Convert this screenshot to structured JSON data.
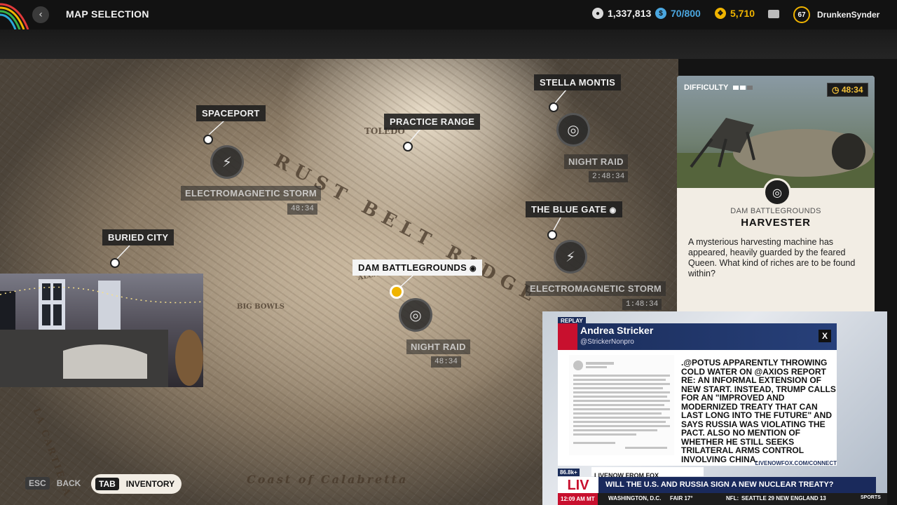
{
  "header": {
    "title": "MAP SELECTION",
    "currency_a": "1,337,813",
    "currency_b": "70/800",
    "currency_c": "5,710",
    "level": "67",
    "username": "DrunkenSynder"
  },
  "map": {
    "region_labels": [
      "RUST BELT RIDGE",
      "TOLEDO",
      "ALCANTARA",
      "BIG BOWLS",
      "LA CARTIERA",
      "Coast of Calabretta"
    ],
    "locations": [
      {
        "name": "SPACEPORT"
      },
      {
        "name": "PRACTICE RANGE"
      },
      {
        "name": "STELLA MONTIS"
      },
      {
        "name": "THE BLUE GATE"
      },
      {
        "name": "BURIED CITY"
      },
      {
        "name": "DAM BATTLEGROUNDS",
        "selected": true
      }
    ],
    "events": [
      {
        "name": "ELECTROMAGNETIC STORM",
        "timer": "48:34"
      },
      {
        "name": "NIGHT RAID",
        "timer": "2:48:34"
      },
      {
        "name": "ELECTROMAGNETIC STORM",
        "timer": "1:48:34"
      },
      {
        "name": "NIGHT RAID",
        "timer": "48:34"
      }
    ]
  },
  "card": {
    "difficulty_label": "DIFFICULTY",
    "difficulty_level": 0.4,
    "time": "48:34",
    "map": "DAM BATTLEGROUNDS",
    "event": "HARVESTER",
    "description": "A mysterious harvesting machine has appeared, heavily guarded by the feared Queen. What kind of riches are to be found within?"
  },
  "footer": {
    "back_key": "ESC",
    "back_label": "BACK",
    "inventory_key": "TAB",
    "inventory_label": "INVENTORY"
  },
  "news": {
    "replay": "REPLAY",
    "author": "Andrea Stricker",
    "handle": "@StrickerNonpro",
    "body": ".@POTUS APPARENTLY THROWING COLD WATER ON @AXIOS REPORT RE: AN INFORMAL EXTENSION OF NEW START. INSTEAD, TRUMP CALLS FOR AN \"IMPROVED AND MODERNIZED TREATY THAT CAN LAST LONG INTO THE FUTURE\" AND SAYS RUSSIA WAS VIOLATING THE PACT. ALSO NO MENTION OF WHETHER HE STILL SEEKS TRILATERAL ARMS CONTROL INVOLVING CHINA.",
    "source_url": "LIVENOWFOX.COM/CONNECT",
    "viewers": "86.8k+",
    "channel": "LIVENOW FROM FOX",
    "headline": "WILL THE U.S. AND RUSSIA SIGN A NEW NUCLEAR TREATY?",
    "time": "12:09 AM MT",
    "city": "WASHINGTON, D.C.",
    "weather": "FAIR 17°",
    "score_label": "NFL:",
    "score_text": "SEATTLE 29 NEW ENGLAND 13",
    "sports": "SPORTS"
  },
  "colors": {
    "accent_gold": "#f0b400",
    "card_bg": "#f2ede4",
    "topbar_bg": "#121212"
  }
}
